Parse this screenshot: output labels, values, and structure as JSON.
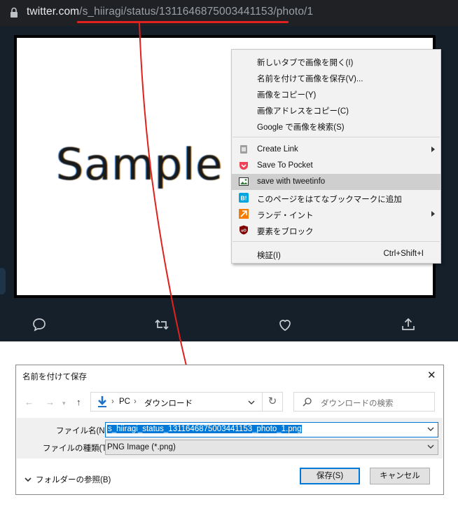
{
  "browser": {
    "url_host": "twitter.com",
    "url_path": "/s_hiiragi/status/1311646875003441153/photo/1"
  },
  "photo": {
    "text": "Sample"
  },
  "tweet_actions": {
    "reply_icon": "reply-icon",
    "retweet_icon": "retweet-icon",
    "like_icon": "heart-icon",
    "share_icon": "share-icon"
  },
  "context_menu": {
    "items": [
      {
        "label": "新しいタブで画像を開く(I)"
      },
      {
        "label": "名前を付けて画像を保存(V)..."
      },
      {
        "label": "画像をコピー(Y)"
      },
      {
        "label": "画像アドレスをコピー(C)"
      },
      {
        "label": "Google で画像を検索(S)"
      }
    ],
    "extensions": [
      {
        "label": "Create Link",
        "icon": "create-link-icon"
      },
      {
        "label": "Save To Pocket",
        "icon": "pocket-icon"
      },
      {
        "label": "save with tweetinfo",
        "icon": "tweetinfo-icon",
        "highlighted": true
      },
      {
        "label": "このページをはてなブックマークに追加",
        "icon": "hatena-bookmark-icon"
      },
      {
        "label": "ランデ・イント",
        "icon": "rande-int-icon"
      },
      {
        "label": "要素をブロック",
        "icon": "ublock-icon"
      }
    ],
    "inspect": {
      "label": "検証(I)",
      "shortcut": "Ctrl+Shift+I"
    }
  },
  "dialog": {
    "title": "名前を付けて保存",
    "path": [
      "PC",
      "ダウンロード"
    ],
    "search_placeholder": "ダウンロードの検索",
    "filename_label": "ファイル名(N):",
    "filename": "s_hiiragi_status_1311646875003441153_photo_1.png",
    "filetype_label": "ファイルの種類(T):",
    "filetype": "PNG Image (*.png)",
    "browse_folders": "フォルダーの参照(B)",
    "save_button": "保存(S)",
    "cancel_button": "キャンセル"
  },
  "colors": {
    "annotation": "#e0211f",
    "twitter_bg": "#15202b",
    "dialog_accent": "#0078d7"
  }
}
